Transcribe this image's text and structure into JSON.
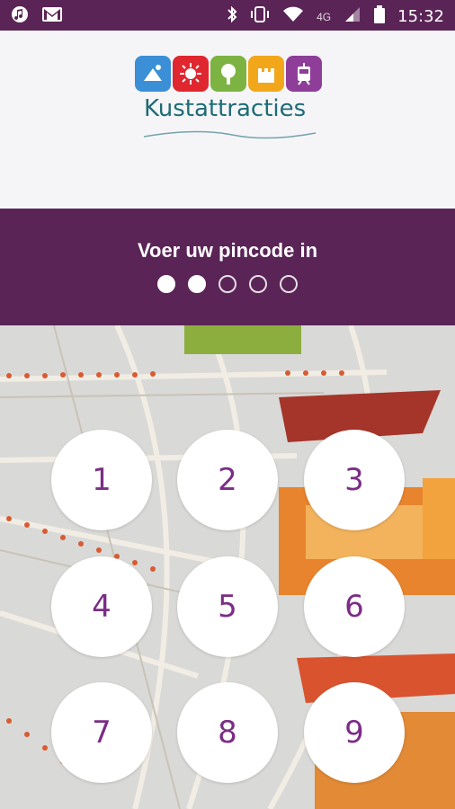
{
  "status_bar": {
    "time": "15:32",
    "network": "4G",
    "icons": [
      "music-icon",
      "gmail-icon",
      "bluetooth-icon",
      "vibrate-icon",
      "wifi-icon",
      "signal-icon",
      "battery-icon"
    ]
  },
  "header": {
    "brand": "Kustattracties",
    "logo_colors": [
      "#3a8fd6",
      "#e0262e",
      "#7cb342",
      "#f2a71b",
      "#8e3d99"
    ]
  },
  "pin": {
    "title": "Voer uw pincode in",
    "digits_total": 5,
    "digits_entered": 2
  },
  "keypad": {
    "keys": [
      "1",
      "2",
      "3",
      "4",
      "5",
      "6",
      "7",
      "8",
      "9"
    ]
  },
  "colors": {
    "purple": "#5a2456",
    "digit": "#7b2d86",
    "brand_text": "#1e6c77"
  }
}
